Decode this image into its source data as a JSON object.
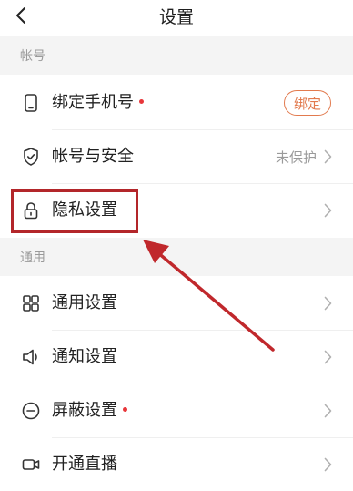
{
  "header": {
    "title": "设置",
    "back_icon": "chevron-left-icon"
  },
  "sections": {
    "account": {
      "title": "帐号",
      "items": {
        "bind_phone": {
          "label": "绑定手机号",
          "icon": "phone-icon",
          "has_red_dot": true,
          "action_button": "绑定",
          "accent_color": "#e27a4e"
        },
        "account_security": {
          "label": "帐号与安全",
          "icon": "shield-check-icon",
          "status": "未保护"
        },
        "privacy": {
          "label": "隐私设置",
          "icon": "lock-icon",
          "highlighted": true,
          "highlight_color": "#b3262a"
        }
      }
    },
    "general": {
      "title": "通用",
      "items": {
        "general_settings": {
          "label": "通用设置",
          "icon": "grid-icon"
        },
        "notifications": {
          "label": "通知设置",
          "icon": "speaker-icon"
        },
        "block": {
          "label": "屏蔽设置",
          "icon": "minus-circle-icon",
          "has_red_dot": true
        },
        "live": {
          "label": "开通直播",
          "icon": "video-icon"
        }
      }
    }
  },
  "annotation": {
    "arrow_color": "#c0282c",
    "arrow_icon": "arrow-icon"
  }
}
